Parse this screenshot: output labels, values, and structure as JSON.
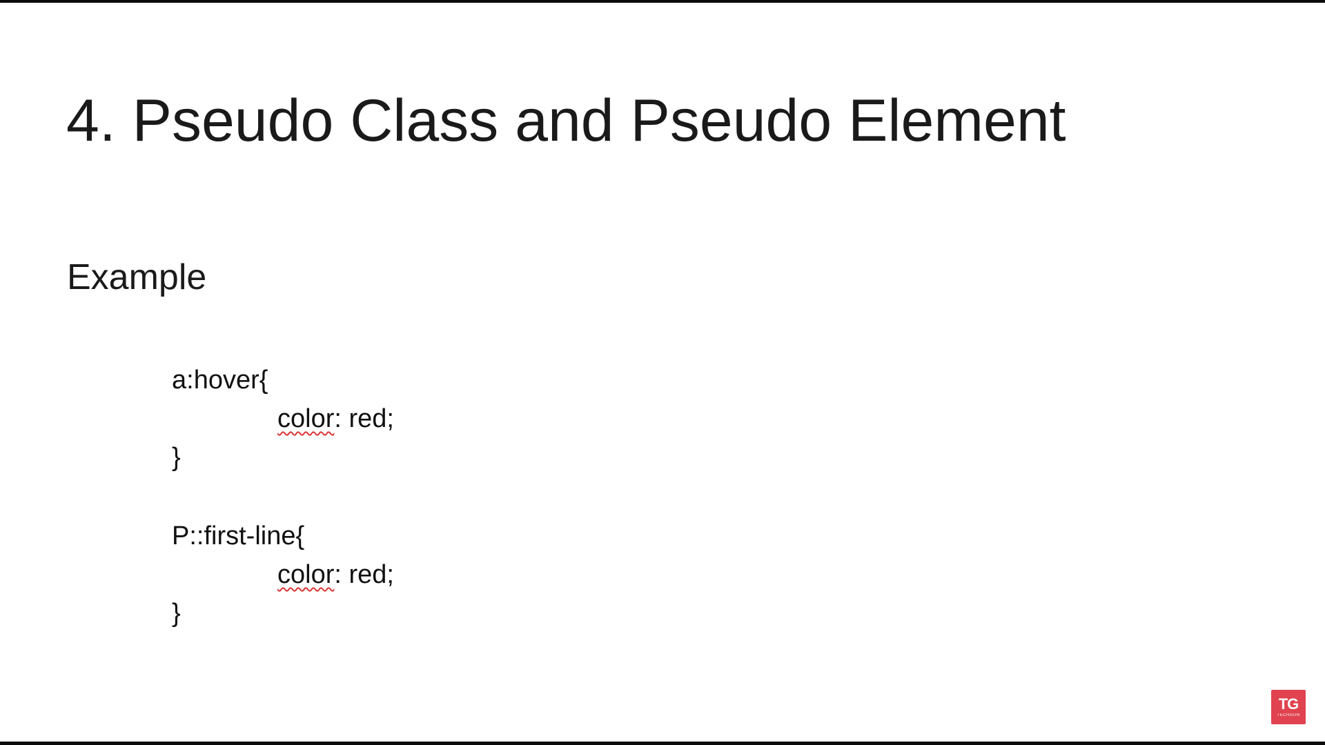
{
  "slide": {
    "title": "4. Pseudo Class and Pseudo Element",
    "subtitle": "Example",
    "code": {
      "block1": {
        "open": "a:hover{",
        "prop": "color",
        "rest": ": red;",
        "close": "}"
      },
      "block2": {
        "open": "P::first-line{",
        "prop": "color",
        "rest": ": red;",
        "close": "}"
      }
    }
  },
  "logo": {
    "mark": "TG",
    "brand": "TECHGUN",
    "color": "#e0434f"
  }
}
